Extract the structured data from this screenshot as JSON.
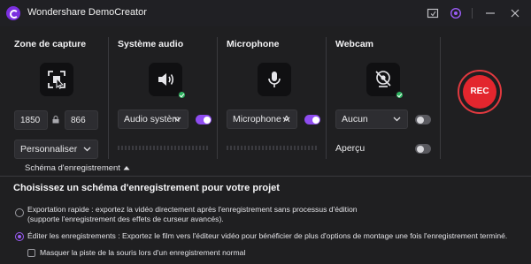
{
  "titlebar": {
    "title": "Wondershare DemoCreator",
    "logo_icon": "democreator-logo-icon",
    "controls": [
      "screenshot-icon",
      "settings-icon",
      "minimize-icon",
      "close-icon"
    ],
    "brand_color": "#7b2fe0"
  },
  "capture": {
    "label": "Zone de capture",
    "icon": "capture-area-icon",
    "width": "1850",
    "height": "866",
    "lock_icon": "lock-icon",
    "preset": "Personnaliser"
  },
  "audio": {
    "label": "Système audio",
    "icon": "speaker-icon",
    "device": "Audio systèm",
    "enabled": true
  },
  "microphone": {
    "label": "Microphone",
    "icon": "microphone-icon",
    "device": "Microphone A",
    "enabled": true
  },
  "webcam": {
    "label": "Webcam",
    "icon": "webcam-off-icon",
    "device": "Aucun",
    "enabled": false,
    "preview_label": "Aperçu",
    "preview_enabled": false
  },
  "record": {
    "label": "REC",
    "color": "#e3262e"
  },
  "scheme": {
    "tab_label": "Schéma d'enregistrement",
    "heading": "Choisissez un schéma d'enregistrement pour votre projet",
    "options": [
      {
        "line1": "Exportation rapide : exportez la vidéo directement après l'enregistrement sans processus d'édition",
        "line2": "(supporte l'enregistrement des effets de curseur avancés).",
        "checked": false
      },
      {
        "line1": "Éditer les enregistrements : Exportez le film vers l'éditeur vidéo pour bénéficier de plus d'options de montage une fois l'enregistrement terminé.",
        "checked": true
      }
    ],
    "hide_mouse_label": "Masquer la piste de la souris lors d'un enregistrement normal",
    "hide_mouse_checked": false
  },
  "colors": {
    "accent": "#8e4cf0",
    "status_ok": "#2cb35f"
  }
}
